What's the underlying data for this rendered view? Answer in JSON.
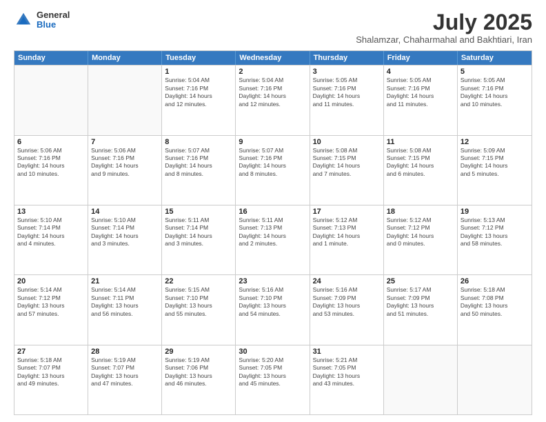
{
  "logo": {
    "general": "General",
    "blue": "Blue"
  },
  "title": "July 2025",
  "subtitle": "Shalamzar, Chaharmahal and Bakhtiari, Iran",
  "header_days": [
    "Sunday",
    "Monday",
    "Tuesday",
    "Wednesday",
    "Thursday",
    "Friday",
    "Saturday"
  ],
  "rows": [
    [
      {
        "day": "",
        "info": ""
      },
      {
        "day": "",
        "info": ""
      },
      {
        "day": "1",
        "info": "Sunrise: 5:04 AM\nSunset: 7:16 PM\nDaylight: 14 hours\nand 12 minutes."
      },
      {
        "day": "2",
        "info": "Sunrise: 5:04 AM\nSunset: 7:16 PM\nDaylight: 14 hours\nand 12 minutes."
      },
      {
        "day": "3",
        "info": "Sunrise: 5:05 AM\nSunset: 7:16 PM\nDaylight: 14 hours\nand 11 minutes."
      },
      {
        "day": "4",
        "info": "Sunrise: 5:05 AM\nSunset: 7:16 PM\nDaylight: 14 hours\nand 11 minutes."
      },
      {
        "day": "5",
        "info": "Sunrise: 5:05 AM\nSunset: 7:16 PM\nDaylight: 14 hours\nand 10 minutes."
      }
    ],
    [
      {
        "day": "6",
        "info": "Sunrise: 5:06 AM\nSunset: 7:16 PM\nDaylight: 14 hours\nand 10 minutes."
      },
      {
        "day": "7",
        "info": "Sunrise: 5:06 AM\nSunset: 7:16 PM\nDaylight: 14 hours\nand 9 minutes."
      },
      {
        "day": "8",
        "info": "Sunrise: 5:07 AM\nSunset: 7:16 PM\nDaylight: 14 hours\nand 8 minutes."
      },
      {
        "day": "9",
        "info": "Sunrise: 5:07 AM\nSunset: 7:16 PM\nDaylight: 14 hours\nand 8 minutes."
      },
      {
        "day": "10",
        "info": "Sunrise: 5:08 AM\nSunset: 7:15 PM\nDaylight: 14 hours\nand 7 minutes."
      },
      {
        "day": "11",
        "info": "Sunrise: 5:08 AM\nSunset: 7:15 PM\nDaylight: 14 hours\nand 6 minutes."
      },
      {
        "day": "12",
        "info": "Sunrise: 5:09 AM\nSunset: 7:15 PM\nDaylight: 14 hours\nand 5 minutes."
      }
    ],
    [
      {
        "day": "13",
        "info": "Sunrise: 5:10 AM\nSunset: 7:14 PM\nDaylight: 14 hours\nand 4 minutes."
      },
      {
        "day": "14",
        "info": "Sunrise: 5:10 AM\nSunset: 7:14 PM\nDaylight: 14 hours\nand 3 minutes."
      },
      {
        "day": "15",
        "info": "Sunrise: 5:11 AM\nSunset: 7:14 PM\nDaylight: 14 hours\nand 3 minutes."
      },
      {
        "day": "16",
        "info": "Sunrise: 5:11 AM\nSunset: 7:13 PM\nDaylight: 14 hours\nand 2 minutes."
      },
      {
        "day": "17",
        "info": "Sunrise: 5:12 AM\nSunset: 7:13 PM\nDaylight: 14 hours\nand 1 minute."
      },
      {
        "day": "18",
        "info": "Sunrise: 5:12 AM\nSunset: 7:12 PM\nDaylight: 14 hours\nand 0 minutes."
      },
      {
        "day": "19",
        "info": "Sunrise: 5:13 AM\nSunset: 7:12 PM\nDaylight: 13 hours\nand 58 minutes."
      }
    ],
    [
      {
        "day": "20",
        "info": "Sunrise: 5:14 AM\nSunset: 7:12 PM\nDaylight: 13 hours\nand 57 minutes."
      },
      {
        "day": "21",
        "info": "Sunrise: 5:14 AM\nSunset: 7:11 PM\nDaylight: 13 hours\nand 56 minutes."
      },
      {
        "day": "22",
        "info": "Sunrise: 5:15 AM\nSunset: 7:10 PM\nDaylight: 13 hours\nand 55 minutes."
      },
      {
        "day": "23",
        "info": "Sunrise: 5:16 AM\nSunset: 7:10 PM\nDaylight: 13 hours\nand 54 minutes."
      },
      {
        "day": "24",
        "info": "Sunrise: 5:16 AM\nSunset: 7:09 PM\nDaylight: 13 hours\nand 53 minutes."
      },
      {
        "day": "25",
        "info": "Sunrise: 5:17 AM\nSunset: 7:09 PM\nDaylight: 13 hours\nand 51 minutes."
      },
      {
        "day": "26",
        "info": "Sunrise: 5:18 AM\nSunset: 7:08 PM\nDaylight: 13 hours\nand 50 minutes."
      }
    ],
    [
      {
        "day": "27",
        "info": "Sunrise: 5:18 AM\nSunset: 7:07 PM\nDaylight: 13 hours\nand 49 minutes."
      },
      {
        "day": "28",
        "info": "Sunrise: 5:19 AM\nSunset: 7:07 PM\nDaylight: 13 hours\nand 47 minutes."
      },
      {
        "day": "29",
        "info": "Sunrise: 5:19 AM\nSunset: 7:06 PM\nDaylight: 13 hours\nand 46 minutes."
      },
      {
        "day": "30",
        "info": "Sunrise: 5:20 AM\nSunset: 7:05 PM\nDaylight: 13 hours\nand 45 minutes."
      },
      {
        "day": "31",
        "info": "Sunrise: 5:21 AM\nSunset: 7:05 PM\nDaylight: 13 hours\nand 43 minutes."
      },
      {
        "day": "",
        "info": ""
      },
      {
        "day": "",
        "info": ""
      }
    ]
  ]
}
